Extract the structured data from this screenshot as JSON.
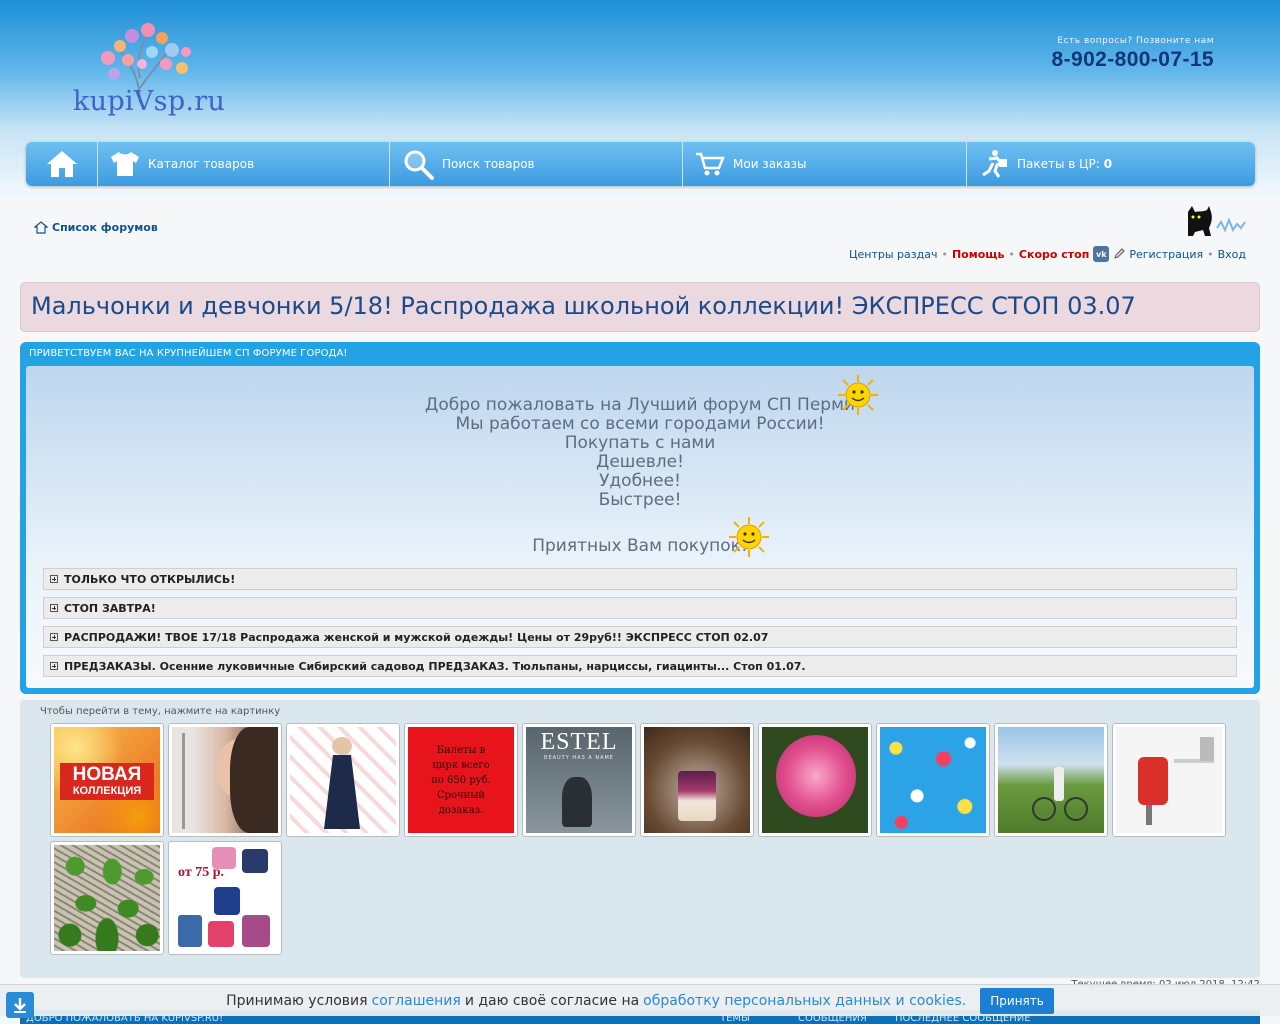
{
  "header": {
    "logo_text": "kupiVsp.ru",
    "contact_label": "Есть вопросы? Позвоните нам",
    "contact_phone": "8-902-800-07-15"
  },
  "nav": {
    "catalog": "Каталог товаров",
    "search": "Поиск товаров",
    "orders": "Мои заказы",
    "packages_label": "Пакеты в ЦР:",
    "packages_count": "0"
  },
  "breadcrumb": {
    "forum_list": "Список форумов"
  },
  "userlinks": {
    "centers": "Центры раздач",
    "help": "Помощь",
    "soon_stop": "Скоро стоп",
    "vk": "vk",
    "register": "Регистрация",
    "login": "Вход",
    "sep": "•"
  },
  "topic": {
    "title": "Мальчонки и девчонки 5/18! Распродажа школьной коллекции! ЭКСПРЕСС СТОП 03.07"
  },
  "welcome": {
    "header": "ПРИВЕТСТВУЕМ ВАС НА КРУПНЕЙШЕМ СП ФОРУМЕ ГОРОДА!",
    "lines": [
      "Добро пожаловать на Лучший форум СП Перми",
      "Мы работаем со всеми городами России!",
      "Покупать с нами",
      "Дешевле!",
      "Удобнее!",
      "Быстрее!"
    ],
    "closing": "Приятных Вам покупок!",
    "spoilers": [
      "ТОЛЬКО ЧТО ОТКРЫЛИСЬ!",
      "СТОП ЗАВТРА!",
      "РАСПРОДАЖИ! ТВОЕ 17/18 Распродажа женской и мужской одежды! Цены от 29руб!! ЭКСПРЕСС СТОП 02.07",
      "ПРЕДЗАКАЗЫ. Осенние луковичные Сибирский садовод ПРЕДЗАКАЗ. Тюльпаны, нарциссы, гиацинты... Стоп 01.07."
    ]
  },
  "banners": {
    "hint": "Чтобы перейти в тему, нажмите на картинку",
    "new_collection_1": "НОВАЯ",
    "new_collection_2": "КОЛЛЕКЦИЯ",
    "circus_text": "Билеты в цирк всего по 650 руб. Срочный дозаказ.",
    "estel": "ESTEL",
    "estel_sub": "BEAUTY HAS A NAME",
    "from_price": "от 75 р."
  },
  "footer": {
    "time": "Текущее время: 02 июл 2018, 12:42",
    "stats_welcome": "ДОБРО ПОЖАЛОВАТЬ НА KUPIVSP.RU!",
    "stats_topics": "ТЕМЫ",
    "stats_posts": "СООБЩЕНИЯ",
    "stats_last": "ПОСЛЕДНЕЕ СООБЩЕНИЕ"
  },
  "cookie": {
    "prefix": "Принимаю условия",
    "link1": "соглашения",
    "middle": "и даю своё согласие на",
    "link2": "обработку персональных данных и cookies.",
    "accept": "Принять"
  }
}
